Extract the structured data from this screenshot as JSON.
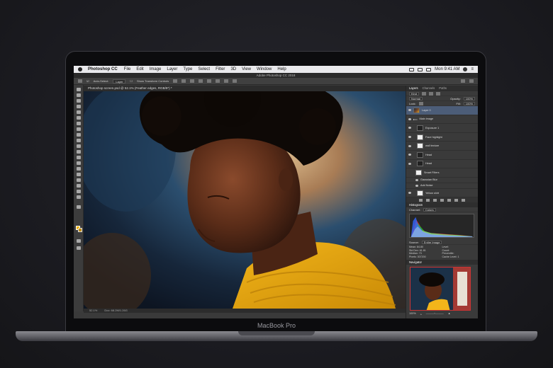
{
  "device": {
    "brand": "MacBook Pro"
  },
  "menubar": {
    "app": "Photoshop CC",
    "items": [
      "File",
      "Edit",
      "Image",
      "Layer",
      "Type",
      "Select",
      "Filter",
      "3D",
      "View",
      "Window",
      "Help"
    ],
    "clock": "Mon 9:41 AM"
  },
  "window": {
    "title": "Adobe Photoshop CC 2018"
  },
  "options_bar": {
    "auto_select": "Auto-Select:",
    "auto_select_value": "Layer",
    "show_transform": "Show Transform Controls"
  },
  "document": {
    "tab": "Photoshop screen.psd @ 52.1% (Feather edges, RGB/8*) *",
    "zoom": "52.1%",
    "status": "Doc: 68.2M/1.26G"
  },
  "layers_panel": {
    "tabs": [
      "Layers",
      "Channels",
      "Paths"
    ],
    "kind_label": "Kind",
    "blend_mode": "Normal",
    "opacity_label": "Opacity:",
    "opacity": "100%",
    "lock_label": "Lock:",
    "fill_label": "Fill:",
    "fill": "100%",
    "layers": [
      {
        "name": "Layer 0",
        "thumb": "portrait",
        "indent": 0,
        "selected": true
      },
      {
        "name": "Main image",
        "thumb": "group",
        "indent": 0,
        "selected": false
      },
      {
        "name": "Exposure 1",
        "thumb": "adjust",
        "indent": 1,
        "selected": false
      },
      {
        "name": "Face highlight",
        "thumb": "white",
        "indent": 1,
        "selected": false
      },
      {
        "name": "wall texture",
        "thumb": "white",
        "indent": 1,
        "selected": false
      },
      {
        "name": "Head",
        "thumb": "dark",
        "indent": 1,
        "selected": false
      },
      {
        "name": "Head",
        "thumb": "dark",
        "indent": 1,
        "selected": false
      },
      {
        "name": "Smart Filters",
        "thumb": "white",
        "indent": 2,
        "selected": false
      },
      {
        "name": "Gaussian Blur",
        "thumb": "none",
        "indent": 2,
        "selected": false
      },
      {
        "name": "Add Noise",
        "thumb": "none",
        "indent": 2,
        "selected": false
      },
      {
        "name": "Yellow shirt",
        "thumb": "white",
        "indent": 1,
        "selected": false
      }
    ]
  },
  "histogram": {
    "title": "Histogram",
    "channel_label": "Channel:",
    "channel": "Colors",
    "source_label": "Source:",
    "source": "Entire Image",
    "stats": [
      {
        "label": "Mean:",
        "value": "84.80"
      },
      {
        "label": "Level:",
        "value": ""
      },
      {
        "label": "Std Dev:",
        "value": "61.81"
      },
      {
        "label": "Count:",
        "value": ""
      },
      {
        "label": "Median:",
        "value": "73"
      },
      {
        "label": "Percentile:",
        "value": ""
      },
      {
        "label": "Pixels:",
        "value": "307200"
      },
      {
        "label": "Cache Level:",
        "value": "1"
      }
    ]
  },
  "navigator": {
    "title": "Navigator",
    "zoom": "100%"
  }
}
